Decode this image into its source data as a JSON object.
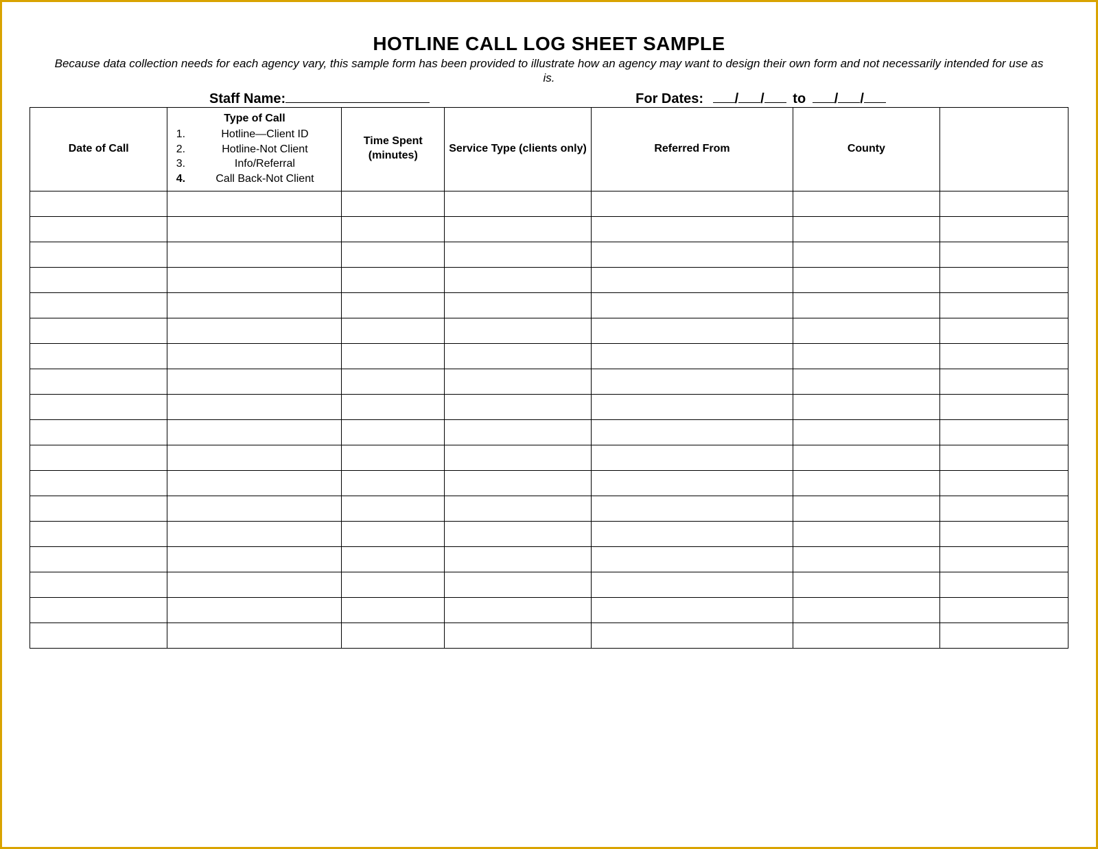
{
  "title": "HOTLINE CALL LOG SHEET SAMPLE",
  "subtitle": "Because data collection needs for each agency vary, this sample form has been provided to illustrate how an agency may want to design their own form and not necessarily intended for use as is.",
  "meta": {
    "staff_label": "Staff Name:",
    "for_dates_label": "For Dates:",
    "to_label": "to"
  },
  "columns": {
    "date_of_call": "Date of Call",
    "type_of_call_title": "Type of Call",
    "type_of_call_options": [
      "Hotline—Client ID",
      "Hotline-Not Client",
      "Info/Referral",
      "Call Back-Not Client"
    ],
    "time_spent": "Time Spent (minutes)",
    "service_type": "Service Type (clients only)",
    "referred_from": "Referred From",
    "county": "County",
    "blank": ""
  },
  "row_count": 18
}
